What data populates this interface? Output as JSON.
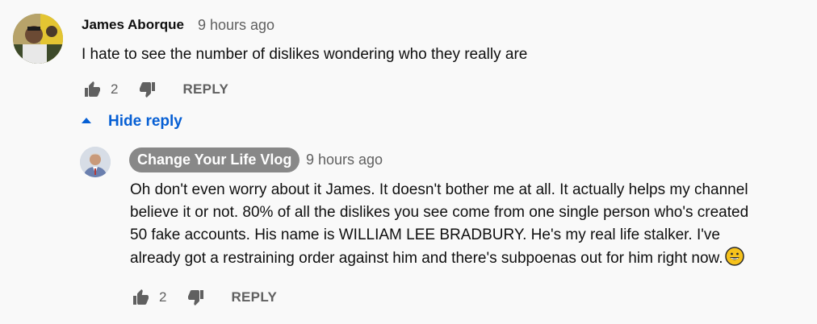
{
  "comment": {
    "author": "James Aborque",
    "time": "9 hours ago",
    "text": "I hate to see the number of dislikes wondering who they really are",
    "likes": "2",
    "reply_label": "REPLY"
  },
  "thread": {
    "hide_reply_label": "Hide reply"
  },
  "reply": {
    "author": "Change Your Life Vlog",
    "time": "9 hours ago",
    "lines": [
      "Oh don't even worry about it James. It doesn't bother me at all. It actually helps my channel",
      "believe it or not. 80% of all the dislikes you see come from one single person who's created",
      "50 fake accounts. His name is WILLIAM LEE BRADBURY. He's my real life stalker. I've",
      "already got a restraining order against him and there's subpoenas out for him right now."
    ],
    "likes": "2",
    "reply_label": "REPLY"
  },
  "icons": {
    "like": "thumbs-up-icon",
    "dislike": "thumbs-down-icon",
    "caret": "caret-up-icon",
    "emoji": "grinning-face-emoji"
  },
  "colors": {
    "background": "#f9f9f9",
    "link": "#065fd4",
    "meta": "#606060",
    "badge": "#888888"
  }
}
